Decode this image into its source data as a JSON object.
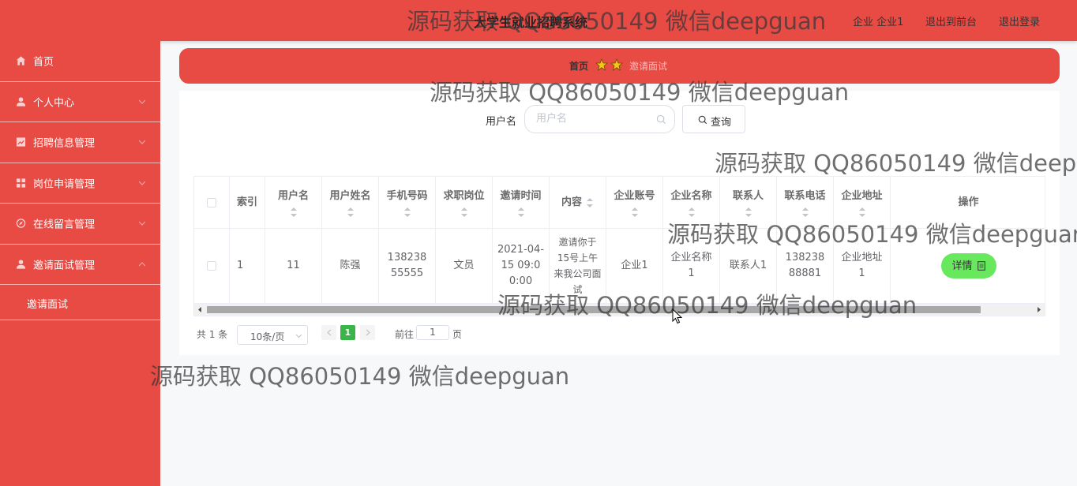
{
  "header": {
    "title": "大学生就业招聘系统",
    "links": [
      "企业 企业1",
      "退出到前台",
      "退出登录"
    ]
  },
  "sidebar": {
    "items": [
      {
        "label": "首页",
        "icon": "home-icon"
      },
      {
        "label": "个人中心",
        "icon": "user-icon"
      },
      {
        "label": "招聘信息管理",
        "icon": "chart-icon"
      },
      {
        "label": "岗位申请管理",
        "icon": "grid-icon"
      },
      {
        "label": "在线留言管理",
        "icon": "compass-icon"
      },
      {
        "label": "邀请面试管理",
        "icon": "user-icon"
      }
    ],
    "subitems": [
      {
        "label": "邀请面试"
      }
    ]
  },
  "breadcrumb": {
    "home": "首页",
    "current": "邀请面试"
  },
  "search": {
    "label": "用户名",
    "placeholder": "用户名",
    "button": "查询"
  },
  "table": {
    "columns": [
      "索引",
      "用户名",
      "用户姓名",
      "手机号码",
      "求职岗位",
      "邀请时间",
      "内容",
      "企业账号",
      "企业名称",
      "联系人",
      "联系电话",
      "企业地址",
      "操作"
    ],
    "rows": [
      {
        "cells": [
          "1",
          "11",
          "陈强",
          "13823855555",
          "文员",
          "2021-04-15 09:00:00",
          "邀请你于15号上午来我公司面试",
          "企业1",
          "企业名称1",
          "联系人1",
          "13823888881",
          "企业地址1"
        ],
        "action": "详情"
      }
    ]
  },
  "pagination": {
    "total": "共 1 条",
    "page_size": "10条/页",
    "current_page": "1",
    "goto_prefix": "前往",
    "goto_value": "1",
    "goto_suffix": "页"
  },
  "watermark": "源码获取 QQ86050149 微信deepguan",
  "colors": {
    "primary": "#e84a44",
    "success": "#67e85d",
    "pager_active": "#3bb54a",
    "star": "#f5c518"
  }
}
